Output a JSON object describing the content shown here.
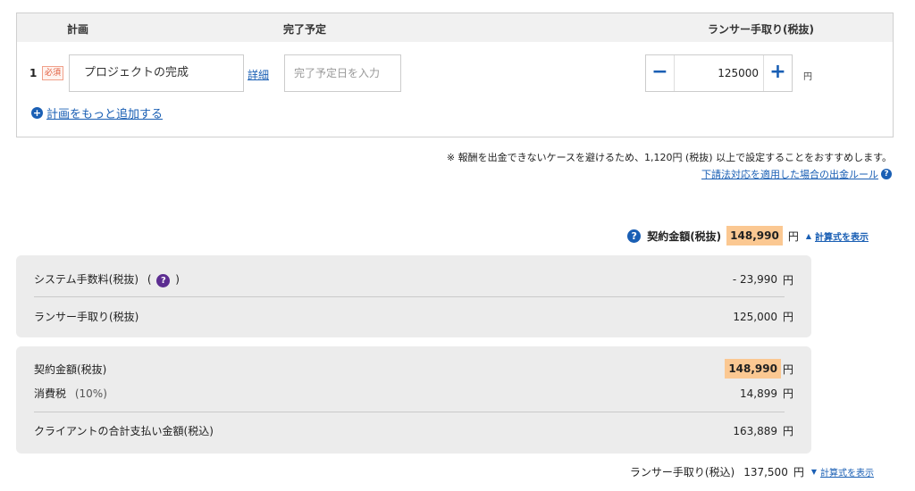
{
  "plan_table": {
    "headers": {
      "plan": "計画",
      "due": "完了予定",
      "fee": "ランサー手取り(税抜)"
    },
    "rows": [
      {
        "number": "1",
        "required_badge": "必須",
        "plan_value": "プロジェクトの完成",
        "detail_link": "詳細",
        "due_placeholder": "完了予定日を入力",
        "amount": "125000",
        "unit": "円"
      }
    ],
    "add_more_label": "計画をもっと追加する"
  },
  "notice": {
    "text": "※ 報酬を出金できないケースを避けるため、1,120円 (税抜) 以上で設定することをおすすめします。",
    "rule_link": "下請法対応を適用した場合の出金ルール"
  },
  "contract_summary": {
    "label": "契約金額(税抜)",
    "amount": "148,990",
    "unit": "円",
    "toggle_label": "計算式を表示"
  },
  "breakdown1": {
    "system_fee_label": "システム手数料(税抜)",
    "system_fee_paren_open": "(",
    "system_fee_paren_close": ")",
    "system_fee_value": "- 23,990",
    "lancer_take_label": "ランサー手取り(税抜)",
    "lancer_take_value": "125,000",
    "unit": "円"
  },
  "breakdown2": {
    "contract_label": "契約金額(税抜)",
    "contract_value": "148,990",
    "tax_label": "消費税",
    "tax_rate": "(10%)",
    "tax_value": "14,899",
    "client_total_label": "クライアントの合計支払い金額(税込)",
    "client_total_value": "163,889",
    "unit": "円"
  },
  "bottom_summary": {
    "label": "ランサー手取り(税込)",
    "value": "137,500",
    "unit": "円",
    "toggle_label": "計算式を表示"
  },
  "colors": {
    "link": "#1a5fb4",
    "highlight": "#fbc892",
    "panel": "#ececec",
    "help_purple": "#5c2d91"
  },
  "icons": {
    "plus_circle": "plus-circle-icon",
    "question": "question-circle-icon",
    "triangle_up": "triangle-up-icon",
    "triangle_down": "triangle-down-icon"
  }
}
